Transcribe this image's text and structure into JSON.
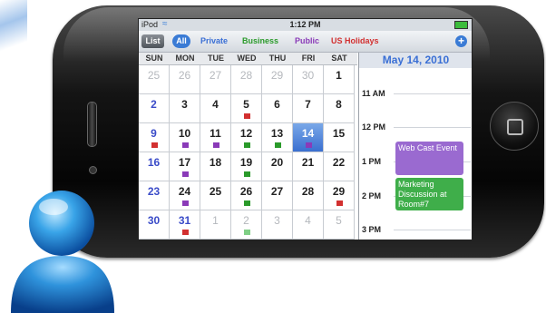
{
  "statusbar": {
    "carrier": "iPod",
    "time": "1:12 PM"
  },
  "toolbar": {
    "list_label": "List",
    "filters": {
      "all": "All",
      "private": "Private",
      "business": "Business",
      "public": "Public",
      "holidays": "US Holidays"
    },
    "add_icon": "plus-circle-icon"
  },
  "calendar": {
    "weekdays": [
      "SUN",
      "MON",
      "TUE",
      "WED",
      "THU",
      "FRI",
      "SAT"
    ],
    "weeks": [
      [
        "25",
        "26",
        "27",
        "28",
        "29",
        "30",
        "1"
      ],
      [
        "2",
        "3",
        "4",
        "5",
        "6",
        "7",
        "8"
      ],
      [
        "9",
        "10",
        "11",
        "12",
        "13",
        "14",
        "15"
      ],
      [
        "16",
        "17",
        "18",
        "19",
        "20",
        "21",
        "22"
      ],
      [
        "23",
        "24",
        "25",
        "26",
        "27",
        "28",
        "29"
      ],
      [
        "30",
        "31",
        "1",
        "2",
        "3",
        "4",
        "5"
      ]
    ],
    "selected_day": "14"
  },
  "dayview": {
    "date": "May 14, 2010",
    "hours": [
      "11 AM",
      "12 PM",
      "1 PM",
      "2 PM",
      "3 PM"
    ],
    "events": [
      {
        "title": "Web Cast Event"
      },
      {
        "title": "Marketing Discussion at Room#7"
      }
    ]
  },
  "colors": {
    "private": "#3a6fd5",
    "business": "#2a9a2a",
    "public": "#8a3ab8",
    "holidays": "#d23030",
    "selected": "#3a6fd0"
  }
}
